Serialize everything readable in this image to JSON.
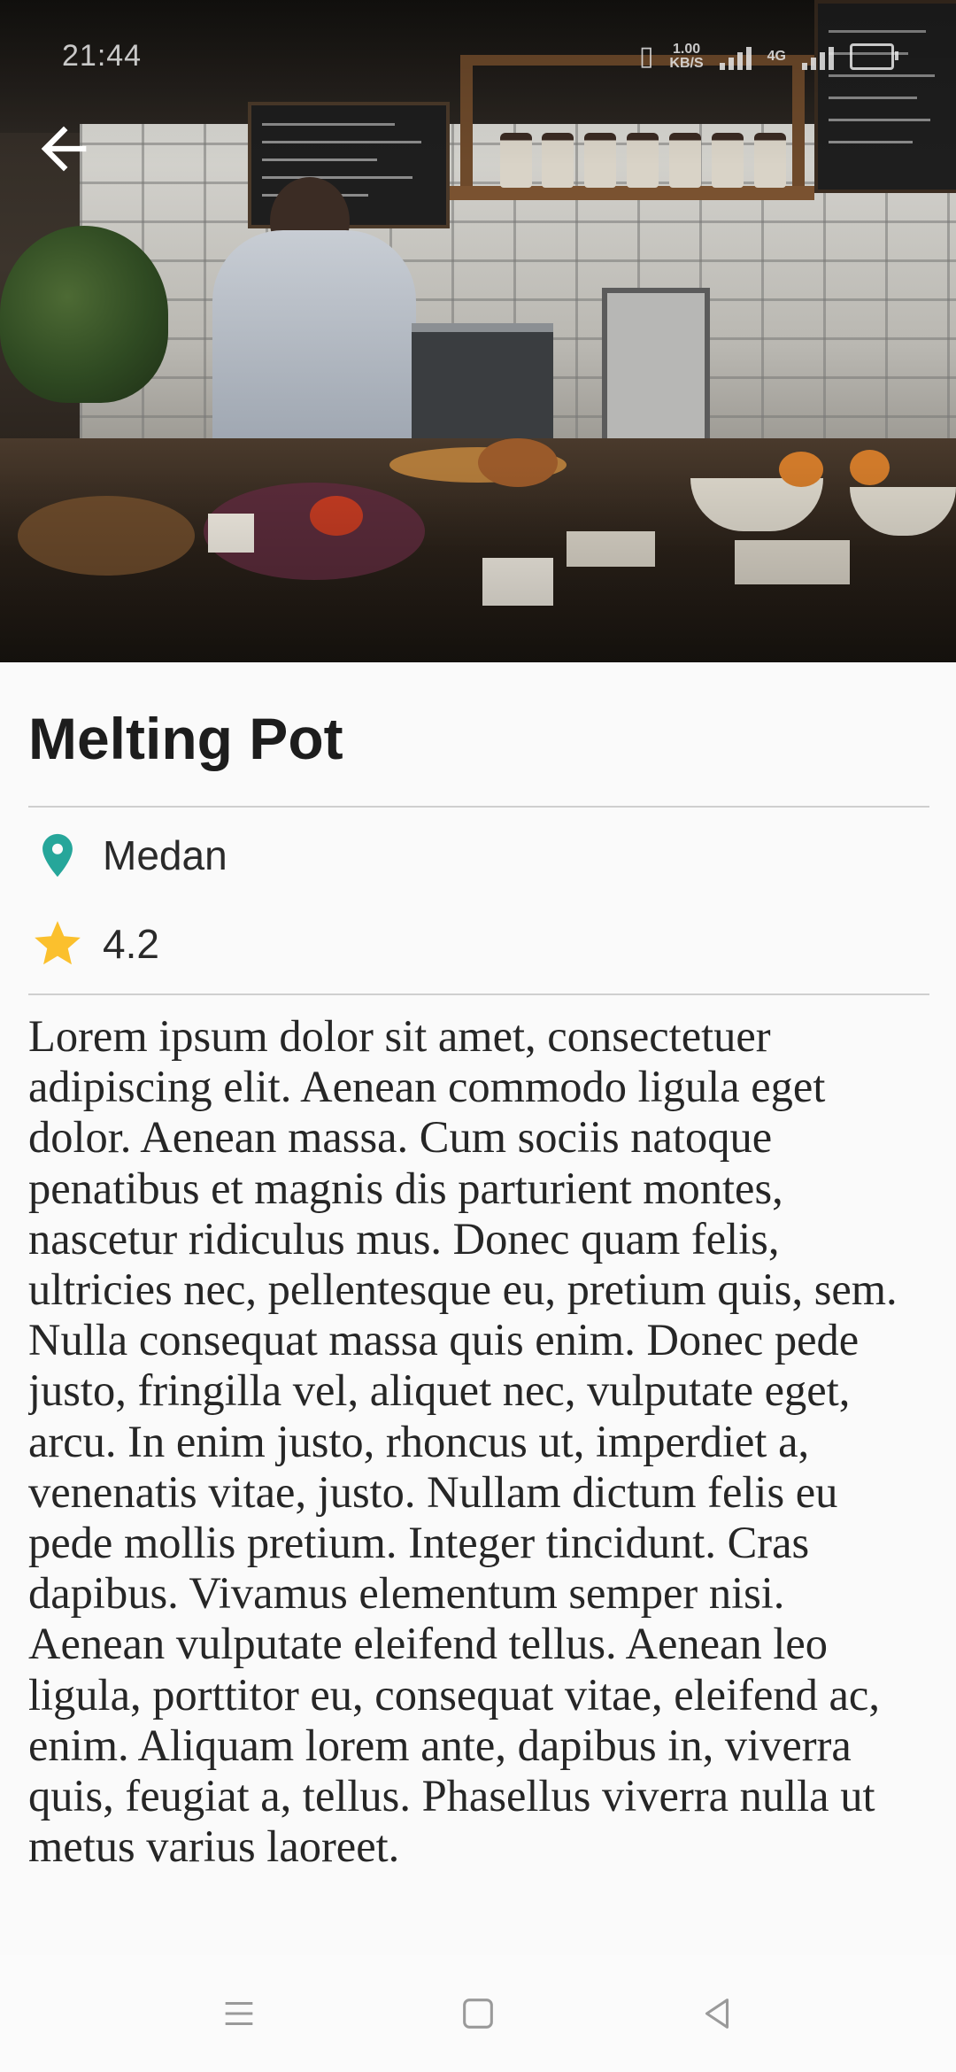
{
  "status_bar": {
    "time": "21:44",
    "network_speed": "1.00\nKB/S",
    "network_type": "4G"
  },
  "place": {
    "name": "Melting Pot",
    "location": "Medan",
    "rating": "4.2",
    "description": "Lorem ipsum dolor sit amet, consectetuer adipiscing elit. Aenean commodo ligula eget dolor. Aenean massa. Cum sociis natoque penatibus et magnis dis parturient montes, nascetur ridiculus mus. Donec quam felis, ultricies nec, pellentesque eu, pretium quis, sem. Nulla consequat massa quis enim. Donec pede justo, fringilla vel, aliquet nec, vulputate eget, arcu. In enim justo, rhoncus ut, imperdiet a, venenatis vitae, justo. Nullam dictum felis eu pede mollis pretium. Integer tincidunt. Cras dapibus. Vivamus elementum semper nisi. Aenean vulputate eleifend tellus. Aenean leo ligula, porttitor eu, consequat vitae, eleifend ac, enim. Aliquam lorem ante, dapibus in, viverra quis, feugiat a, tellus. Phasellus viverra nulla ut metus varius laoreet."
  },
  "icons": {
    "back": "arrow-left-icon",
    "location": "location-pin-icon",
    "rating": "star-icon",
    "nav_menu": "menu-icon",
    "nav_home": "square-home-icon",
    "nav_back": "triangle-back-icon"
  },
  "colors": {
    "pin": "#26a69a",
    "star": "#fbc02d",
    "text": "#1d1d1d",
    "divider": "#cfcfcf",
    "background": "#fafafa"
  }
}
